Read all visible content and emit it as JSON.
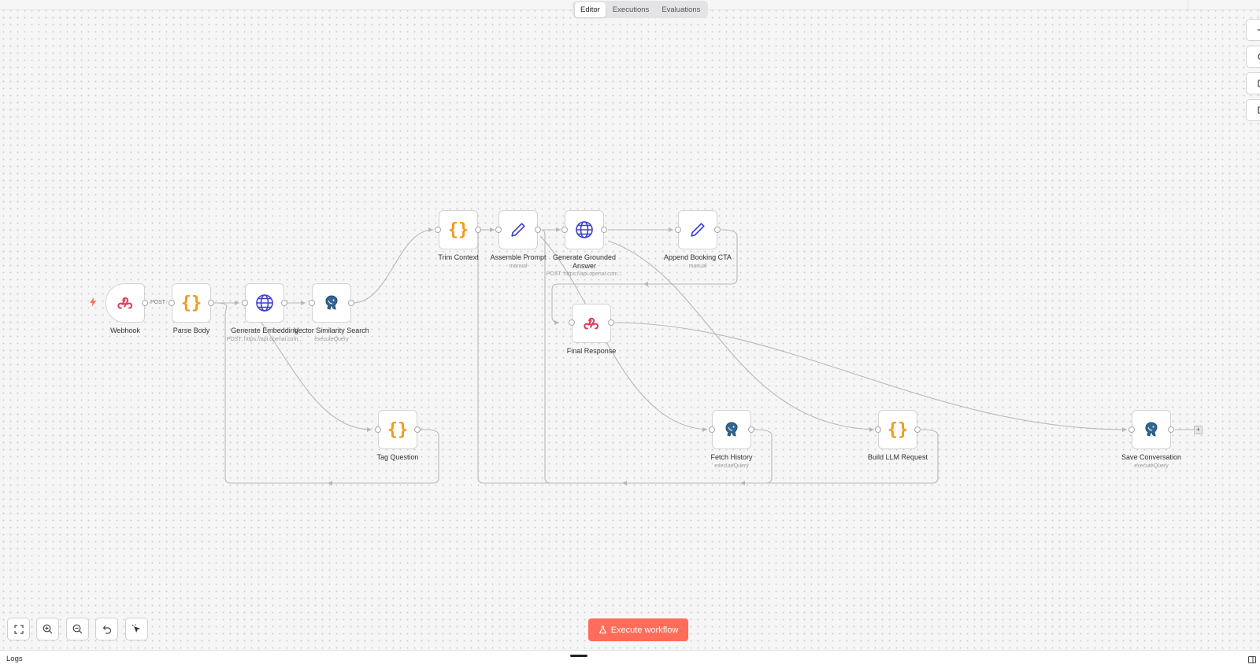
{
  "tabs": {
    "editor": "Editor",
    "executions": "Executions",
    "evaluations": "Evaluations"
  },
  "nodes": {
    "webhook": {
      "title": "Webhook",
      "icon": "webhook-icon"
    },
    "parse_body": {
      "title": "Parse Body",
      "icon": "code-braces-icon"
    },
    "generate_embedding": {
      "title": "Generate Embedding",
      "subtitle": "POST: https://api.openai.com...",
      "icon": "globe-icon"
    },
    "vector_search": {
      "title": "Vector Similarity Search",
      "subtitle": "executeQuery",
      "icon": "postgres-elephant-icon"
    },
    "tag_question": {
      "title": "Tag Question",
      "icon": "code-braces-icon"
    },
    "trim_context": {
      "title": "Trim Context",
      "icon": "code-braces-icon"
    },
    "assemble_prompt": {
      "title": "Assemble Prompt",
      "subtitle": "manual",
      "icon": "pencil-icon"
    },
    "generate_answer": {
      "title": "Generate Grounded Answer",
      "subtitle": "POST: https://api.openai.com...",
      "icon": "globe-icon"
    },
    "append_cta": {
      "title": "Append Booking CTA",
      "subtitle": "manual",
      "icon": "pencil-icon"
    },
    "final_response": {
      "title": "Final Response",
      "icon": "webhook-icon"
    },
    "fetch_history": {
      "title": "Fetch History",
      "subtitle": "executeQuery",
      "icon": "postgres-elephant-icon"
    },
    "build_llm_request": {
      "title": "Build LLM Request",
      "icon": "code-braces-icon"
    },
    "save_conversation": {
      "title": "Save Conversation",
      "subtitle": "executeQuery",
      "icon": "postgres-elephant-icon"
    }
  },
  "edge_labels": {
    "webhook_to_parse": "POST"
  },
  "glyphs": {
    "code": "{}",
    "plus": "+"
  },
  "execute_button": "Execute workflow",
  "logs_label": "Logs",
  "colors": {
    "accent": "#ff6d5a",
    "code_orange": "#f29a1d",
    "globe_blue": "#3c3fd0",
    "webhook_red": "#e03a5a"
  }
}
